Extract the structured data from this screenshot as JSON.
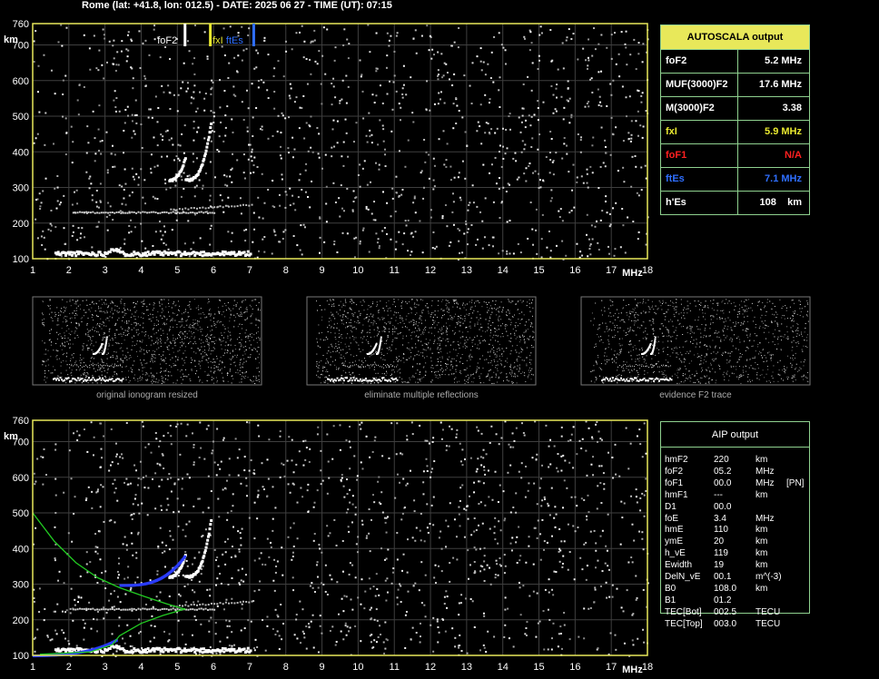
{
  "header": "Rome (lat: +41.8, lon: 012.5) - DATE: 2025 06 27 - TIME (UT): 07:15",
  "colors": {
    "frame": "#e8e85a",
    "grid": "#3f3f3f",
    "table_border": "#8fd18f",
    "title_bg": "#e8e85a",
    "fof2": "#ffffff",
    "fxi": "#e8e830",
    "foes": "#2f6fff",
    "fof1": "#ff2020",
    "aip_curve": "#22cc22",
    "aip_trace": "#2a3cff"
  },
  "axis": {
    "y_unit": "km",
    "x_unit": "MHz",
    "y_ticks": [
      "760",
      "700",
      "600",
      "500",
      "400",
      "300",
      "200",
      "100"
    ],
    "y_values": [
      760,
      700,
      600,
      500,
      400,
      300,
      200,
      100
    ],
    "x_ticks": [
      "1",
      "2",
      "3",
      "4",
      "5",
      "6",
      "7",
      "8",
      "9",
      "10",
      "11",
      "12",
      "13",
      "14",
      "15",
      "16",
      "17",
      "18"
    ],
    "x_values": [
      1,
      2,
      3,
      4,
      5,
      6,
      7,
      8,
      9,
      10,
      11,
      12,
      13,
      14,
      15,
      16,
      17,
      18
    ],
    "x_range": [
      1,
      18
    ],
    "y_range": [
      100,
      760
    ]
  },
  "markers": [
    {
      "label": "foF2",
      "freq": 5.2,
      "color": "#ffffff"
    },
    {
      "label": "fxI",
      "freq": 5.9,
      "color": "#e8e830"
    },
    {
      "label": "ftEs",
      "freq": 7.1,
      "color": "#2f6fff"
    }
  ],
  "autoscala": {
    "title": "AUTOSCALA output",
    "rows": [
      {
        "key": "foF2",
        "value": "5.2 MHz",
        "color": "#ffffff"
      },
      {
        "key": "MUF(3000)F2",
        "value": "17.6 MHz",
        "color": "#ffffff"
      },
      {
        "key": "M(3000)F2",
        "value": "3.38",
        "color": "#ffffff"
      },
      {
        "key": "fxI",
        "value": "5.9 MHz",
        "color": "#e8e830"
      },
      {
        "key": "foF1",
        "value": "N/A",
        "color": "#ff2020"
      },
      {
        "key": "ftEs",
        "value": "7.1 MHz",
        "color": "#2f6fff"
      },
      {
        "key": "h'Es",
        "value": "108    km",
        "color": "#ffffff"
      }
    ]
  },
  "thumbnails": [
    {
      "caption": "original ionogram resized"
    },
    {
      "caption": "eliminate multiple reflections"
    },
    {
      "caption": "evidence F2 trace"
    }
  ],
  "aip": {
    "title": "AIP output",
    "rows": [
      [
        "hmF2",
        "220",
        "km",
        ""
      ],
      [
        "foF2",
        "05.2",
        "MHz",
        ""
      ],
      [
        "foF1",
        "00.0",
        "MHz",
        "[PN]"
      ],
      [
        "hmF1",
        "---",
        "km",
        ""
      ],
      [
        "D1",
        "00.0",
        "",
        ""
      ],
      [
        "foE",
        "3.4",
        "MHz",
        ""
      ],
      [
        "hmE",
        "110",
        "km",
        ""
      ],
      [
        "ymE",
        "20",
        "km",
        ""
      ],
      [
        "h_vE",
        "119",
        "km",
        ""
      ],
      [
        "Ewidth",
        "19",
        "km",
        ""
      ],
      [
        "DelN_vE",
        "00.1",
        "m^(-3)",
        ""
      ],
      [
        "B0",
        "108.0",
        "km",
        ""
      ],
      [
        "B1",
        "01.2",
        "",
        ""
      ],
      [
        "TEC[Bot]",
        "002.5",
        "TECU",
        ""
      ],
      [
        "TEC[Top]",
        "003.0",
        "TECU",
        ""
      ]
    ]
  }
}
